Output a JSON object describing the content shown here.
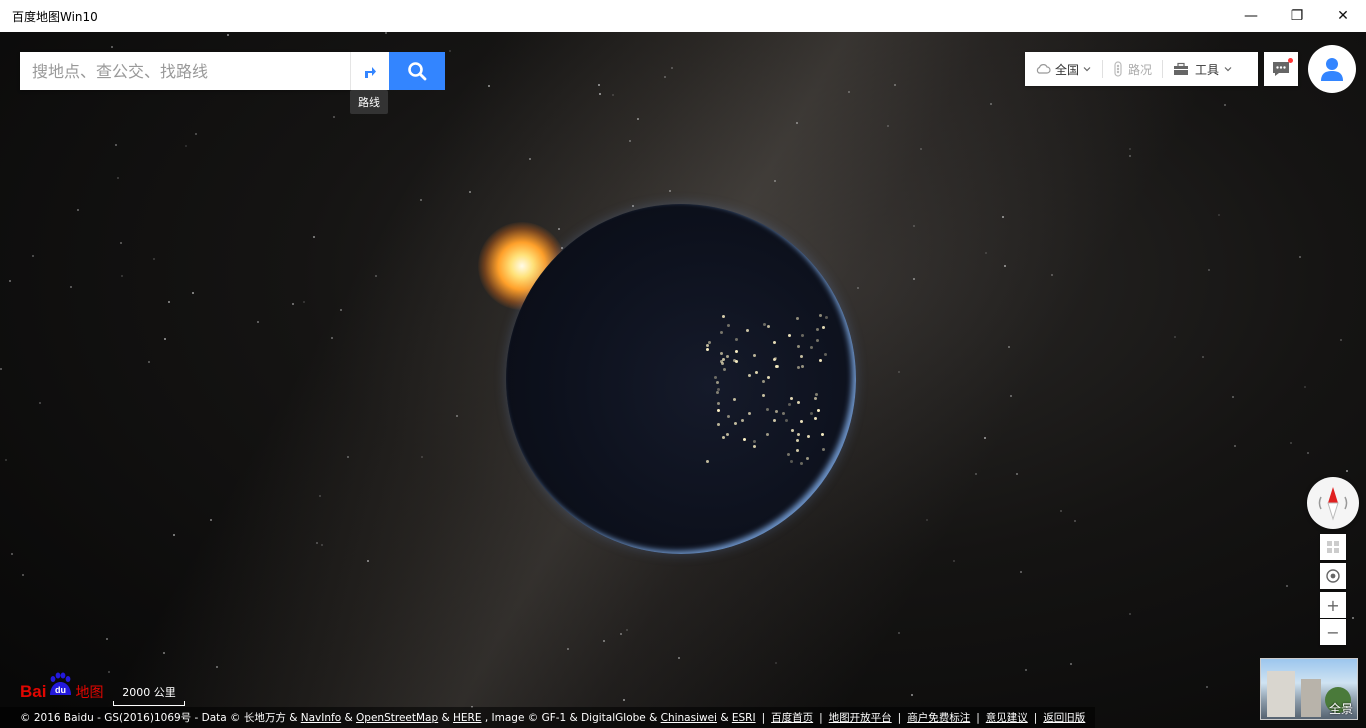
{
  "window": {
    "title": "百度地图Win10",
    "minimize": "—",
    "maximize": "❐",
    "close": "✕"
  },
  "search": {
    "placeholder": "搜地点、查公交、找路线",
    "route_tooltip": "路线"
  },
  "toolbar": {
    "city": "全国",
    "traffic": "路况",
    "tools": "工具"
  },
  "controls": {
    "zoom_in": "+",
    "zoom_out": "−",
    "panorama_label": "全景"
  },
  "logo": {
    "bai": "Bai",
    "du": "du",
    "map": "地图"
  },
  "scale": {
    "label": "2000 公里"
  },
  "footer": {
    "prefix": "© 2016 Baidu - GS(2016)1069号 - Data © 长地万方 &",
    "navinfo": "NavInfo",
    "amp1": "&",
    "osm": "OpenStreetMap",
    "amp2": "&",
    "here": "HERE",
    "image_text": ", Image © GF-1 & DigitalGlobe &",
    "chinasiwei": "Chinasiwei",
    "amp3": "&",
    "esri": "ESRI",
    "links": [
      "百度首页",
      "地图开放平台",
      "商户免费标注",
      "意见建议",
      "返回旧版"
    ]
  },
  "colors": {
    "accent": "#3385ff",
    "brand_red": "#e10601"
  },
  "icons": {
    "route": "route-arrow-icon",
    "search": "search-icon",
    "cloud": "cloud-icon",
    "traffic": "traffic-light-icon",
    "tools": "toolbox-icon",
    "message": "message-icon",
    "user": "user-icon",
    "compass": "compass-icon",
    "grid": "grid-icon",
    "locate": "locate-icon"
  }
}
